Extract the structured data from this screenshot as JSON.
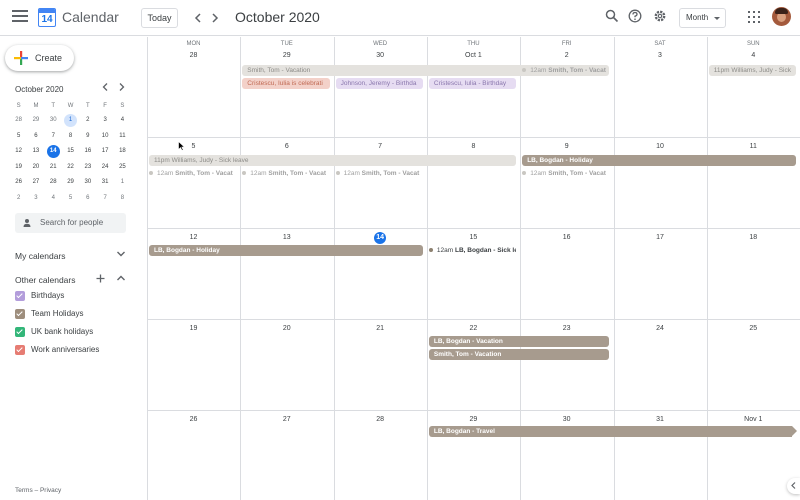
{
  "header": {
    "app_title": "Calendar",
    "logo_number": "14",
    "today_label": "Today",
    "prev_icon": "chevron-left-icon",
    "next_icon": "chevron-right-icon",
    "month_title": "October 2020",
    "view_label": "Month",
    "icons": [
      "search-icon",
      "help-icon",
      "settings-icon",
      "apps-icon"
    ]
  },
  "sidebar": {
    "create_label": "Create",
    "mini_title": "October 2020",
    "mini_dow": [
      "S",
      "M",
      "T",
      "W",
      "T",
      "F",
      "S"
    ],
    "mini_days": [
      [
        "28",
        "29",
        "30",
        "1",
        "2",
        "3",
        "4"
      ],
      [
        "5",
        "6",
        "7",
        "8",
        "9",
        "10",
        "11"
      ],
      [
        "12",
        "13",
        "14",
        "15",
        "16",
        "17",
        "18"
      ],
      [
        "19",
        "20",
        "21",
        "22",
        "23",
        "24",
        "25"
      ],
      [
        "26",
        "27",
        "28",
        "29",
        "30",
        "31",
        "1"
      ],
      [
        "2",
        "3",
        "4",
        "5",
        "6",
        "7",
        "8"
      ]
    ],
    "people_search_placeholder": "Search for people",
    "my_calendars_label": "My calendars",
    "other_calendars_label": "Other calendars",
    "other_calendars": [
      {
        "label": "Birthdays",
        "color": "#b39ddb"
      },
      {
        "label": "Team Holidays",
        "color": "#9e8e7d"
      },
      {
        "label": "UK bank holidays",
        "color": "#33b679"
      },
      {
        "label": "Work anniversaries",
        "color": "#e67c73"
      }
    ],
    "footer_terms": "Terms",
    "footer_sep": "–",
    "footer_privacy": "Privacy"
  },
  "grid": {
    "dow": [
      "MON",
      "TUE",
      "WED",
      "THU",
      "FRI",
      "SAT",
      "SUN"
    ],
    "weeks": [
      [
        "28",
        "29",
        "30",
        "Oct 1",
        "2",
        "3",
        "4"
      ],
      [
        "5",
        "6",
        "7",
        "8",
        "9",
        "10",
        "11"
      ],
      [
        "12",
        "13",
        "14",
        "15",
        "16",
        "17",
        "18"
      ],
      [
        "19",
        "20",
        "21",
        "22",
        "23",
        "24",
        "25"
      ],
      [
        "26",
        "27",
        "28",
        "29",
        "30",
        "31",
        "Nov 1"
      ]
    ],
    "today_label": "14"
  },
  "events": {
    "w1_vacation": "Smith, Tom - Vacation",
    "w1_cristescu_tue": "Cristescu, Iulia is celebrati",
    "w1_johnson": "Johnson, Jeremy - Birthda",
    "w1_cristescu_thu": "Cristescu, Iulia - Birthday",
    "w1_fri_time": "12am",
    "w1_fri_title": "Smith, Tom - Vacat",
    "w1_sun": "11pm Williams, Judy - Sick",
    "w2_sick": "11pm Williams, Judy - Sick leave",
    "w2_holiday": "LB, Bogdan - Holiday",
    "w2_dot_time": "12am",
    "w2_dot_title": "Smith, Tom - Vacat",
    "w3_holiday": "LB, Bogdan - Holiday",
    "w3_dot_time": "12am",
    "w3_dot_title": "LB, Bogdan - Sick le",
    "w4_vacation_lb": "LB, Bogdan - Vacation",
    "w4_vacation_st": "Smith, Tom - Vacation",
    "w5_travel": "LB, Bogdan - Travel"
  }
}
